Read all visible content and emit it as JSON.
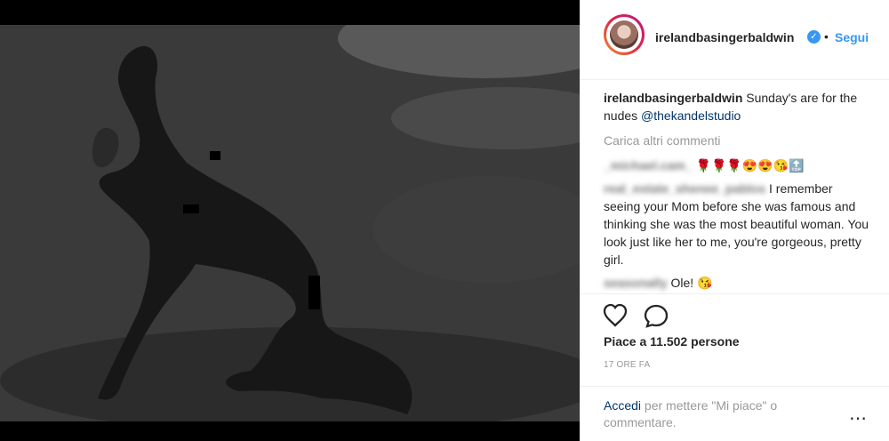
{
  "post": {
    "username": "irelandbasingerbaldwin",
    "follow_label": "Segui",
    "separator": "•",
    "caption_text": " Sunday's are for the nudes ",
    "caption_mention": "@thekandelstudio",
    "load_more": "Carica altri commenti",
    "comments": [
      {
        "user": "_michael.cam_",
        "text": " 🌹🌹🌹😍😍😘🔝"
      },
      {
        "user": "real_estate_shenee_pablos",
        "text": " I remember seeing your Mom before she was famous and thinking she was the most beautiful woman. You look just like her to me, you're gorgeous, pretty girl."
      },
      {
        "user": "seasonally",
        "text": " Ole! 😘"
      }
    ],
    "likes": "Piace a 11.502 persone",
    "date": "17 ORE FA",
    "login_link": "Accedi",
    "login_rest": " per mettere \"Mi piace\" o commentare.",
    "more_label": "⋯"
  },
  "icons": {
    "verified": "✓"
  }
}
